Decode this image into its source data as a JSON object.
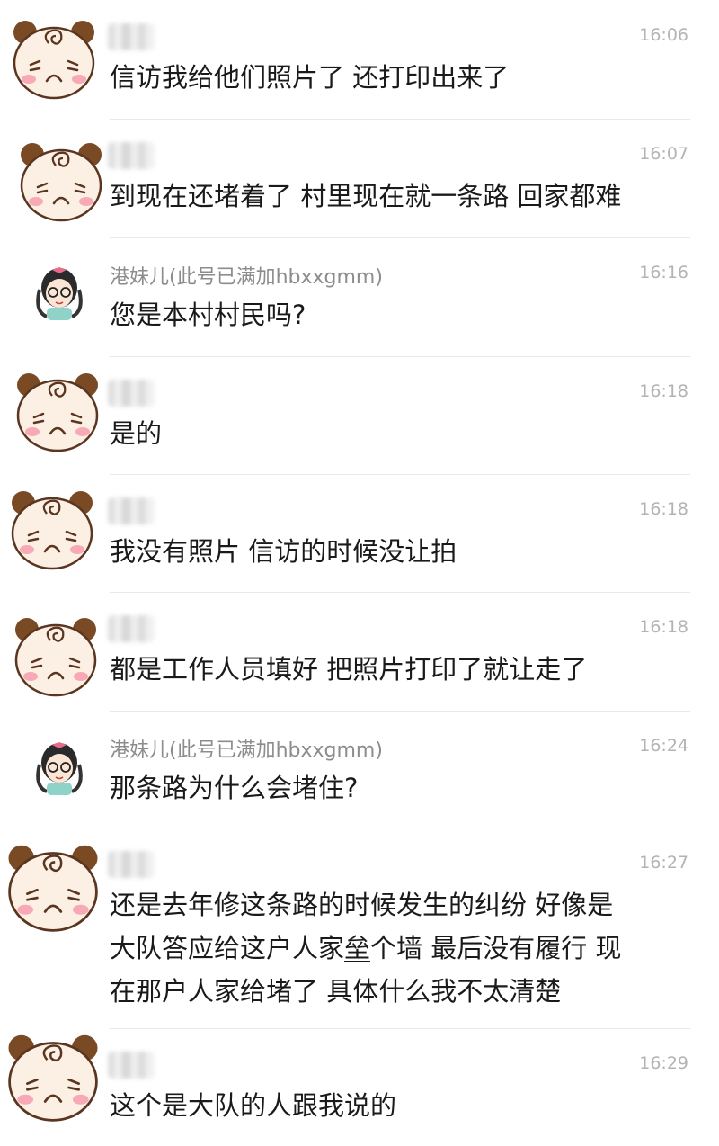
{
  "messages": [
    {
      "sender": "",
      "time": "16:06",
      "text": "信访我给他们照片了  还打印出来了"
    },
    {
      "sender": "",
      "time": "16:07",
      "text": "到现在还堵着了  村里现在就一条路  回家都难"
    },
    {
      "sender": "港妹儿(此号已满加hbxxgmm)",
      "time": "16:16",
      "text": "您是本村村民吗?"
    },
    {
      "sender": "",
      "time": "16:18",
      "text": "是的"
    },
    {
      "sender": "",
      "time": "16:18",
      "text": "我没有照片  信访的时候没让拍"
    },
    {
      "sender": "",
      "time": "16:18",
      "text": "都是工作人员填好  把照片打印了就让走了"
    },
    {
      "sender": "港妹儿(此号已满加hbxxgmm)",
      "time": "16:24",
      "text": "那条路为什么会堵住?"
    },
    {
      "sender": "",
      "time": "16:27",
      "text_lines": [
        "还是去年修这条路的时候发生的纠纷  好像是",
        "个墙  最后没有履行  现",
        "在那户人家给堵了  具体什么我不太清楚"
      ],
      "text_prefix": "大队答应给这户人家",
      "text_underlined": "垒"
    },
    {
      "sender": "",
      "time": "16:29",
      "text": "这个是大队的人跟我说的"
    }
  ]
}
